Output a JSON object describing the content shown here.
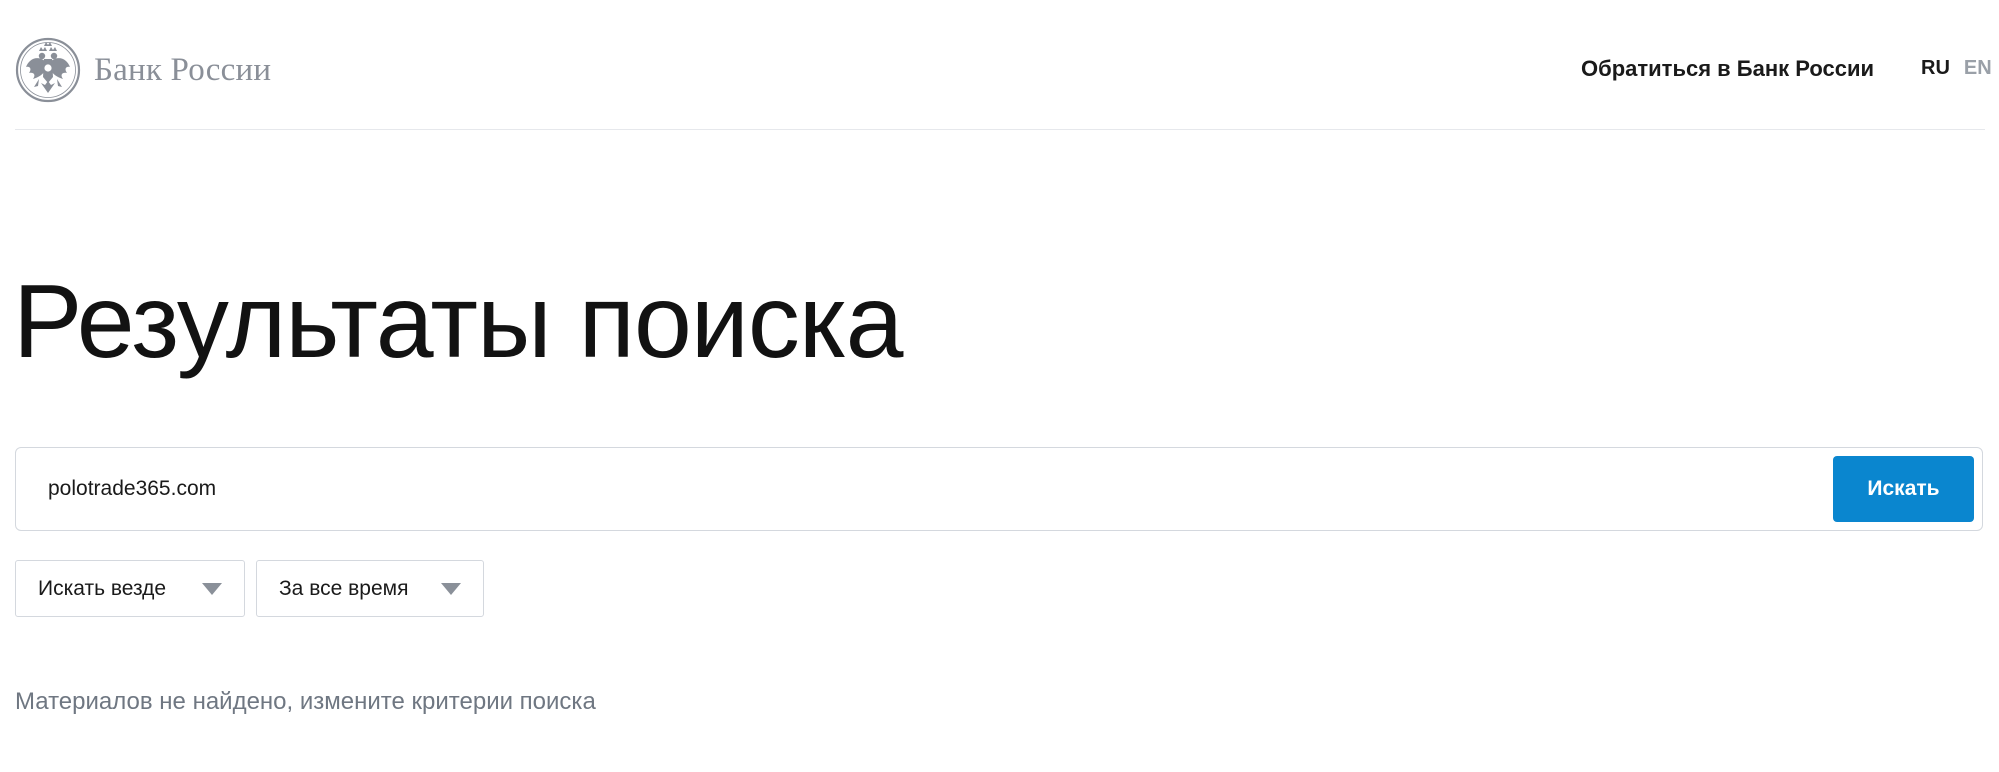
{
  "header": {
    "logo_text": "Банк России",
    "contact_link": "Обратиться в Банк России",
    "languages": [
      {
        "label": "RU",
        "active": true
      },
      {
        "label": "EN",
        "active": false
      }
    ]
  },
  "main": {
    "title": "Результаты поиска",
    "search": {
      "value": "polotrade365.com",
      "button_label": "Искать"
    },
    "filters": {
      "scope": "Искать везде",
      "period": "За все время"
    },
    "no_results_message": "Материалов не найдено, измените критерии поиска"
  },
  "colors": {
    "accent": "#0a86cf",
    "muted_text": "#6f7782",
    "logo_gray": "#8a8f98"
  }
}
